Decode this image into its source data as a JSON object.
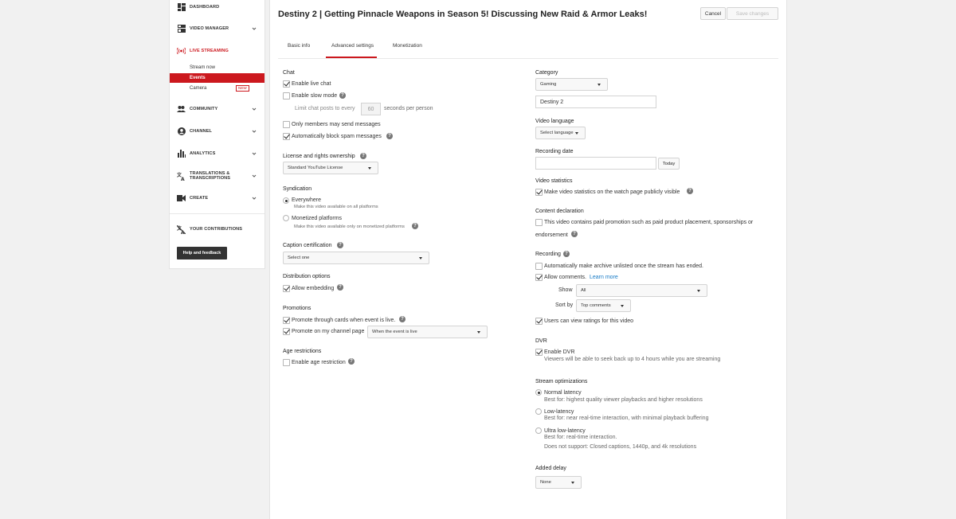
{
  "sidebar": {
    "dashboard": "DASHBOARD",
    "video_manager": "VIDEO MANAGER",
    "live_streaming": "LIVE STREAMING",
    "live_sub": {
      "stream_now": "Stream now",
      "events": "Events",
      "camera": "Camera",
      "new_badge": "NEW"
    },
    "community": "COMMUNITY",
    "channel": "CHANNEL",
    "analytics": "ANALYTICS",
    "translations_line1": "TRANSLATIONS &",
    "translations_line2": "TRANSCRIPTIONS",
    "create": "CREATE",
    "your_contributions": "YOUR CONTRIBUTIONS",
    "help_feedback": "Help and feedback"
  },
  "header": {
    "title": "Destiny 2 | Getting Pinnacle Weapons in Season 5! Discussing New Raid & Armor Leaks!",
    "cancel": "Cancel",
    "save": "Save changes"
  },
  "tabs": [
    "Basic info",
    "Advanced settings",
    "Monetization"
  ],
  "left": {
    "chat": {
      "heading": "Chat",
      "enable_live_chat": "Enable live chat",
      "enable_slow_mode": "Enable slow mode",
      "limit_prefix": "Limit chat posts to every",
      "limit_value": "60",
      "limit_suffix": "seconds per person",
      "members_only": "Only members may send messages",
      "block_spam": "Automatically block spam messages"
    },
    "license": {
      "heading": "License and rights ownership",
      "value": "Standard YouTube License"
    },
    "syndication": {
      "heading": "Syndication",
      "everywhere": "Everywhere",
      "everywhere_desc": "Make this video available on all platforms",
      "monetized": "Monetized platforms",
      "monetized_desc": "Make this video available only on monetized platforms"
    },
    "caption": {
      "heading": "Caption certification",
      "value": "Select one"
    },
    "distribution": {
      "heading": "Distribution options",
      "allow_embedding": "Allow embedding"
    },
    "promotions": {
      "heading": "Promotions",
      "cards": "Promote through cards when event is live.",
      "channel_page": "Promote on my channel page",
      "channel_page_value": "When the event is live"
    },
    "age": {
      "heading": "Age restrictions",
      "enable": "Enable age restriction"
    }
  },
  "right": {
    "category": {
      "heading": "Category",
      "value": "Gaming",
      "game": "Destiny 2"
    },
    "video_language": {
      "heading": "Video language",
      "value": "Select language"
    },
    "recording_date": {
      "heading": "Recording date",
      "value": "",
      "today": "Today"
    },
    "video_statistics": {
      "heading": "Video statistics",
      "label": "Make video statistics on the watch page publicly visible"
    },
    "content_declaration": {
      "heading": "Content declaration",
      "line1": "This video contains paid promotion such as paid product placement, sponsorships or",
      "line2": "endorsement"
    },
    "recording": {
      "heading": "Recording",
      "archive_unlisted": "Automatically make archive unlisted once the stream has ended.",
      "allow_comments": "Allow comments.",
      "learn_more": "Learn more",
      "show_label": "Show",
      "show_value": "All",
      "sort_label": "Sort by",
      "sort_value": "Top comments",
      "ratings": "Users can view ratings for this video"
    },
    "dvr": {
      "heading": "DVR",
      "enable": "Enable DVR",
      "desc": "Viewers will be able to seek back up to 4 hours while you are streaming"
    },
    "stream_opt": {
      "heading": "Stream optimizations",
      "normal": "Normal latency",
      "normal_desc": "Best for: highest quality viewer playbacks and higher resolutions",
      "low": "Low-latency",
      "low_desc": "Best for: near real-time interaction, with minimal playback buffering",
      "ultra": "Ultra low-latency",
      "ultra_desc": "Best for: real-time interaction.",
      "ultra_note": "Does not support: Closed captions, 1440p, and 4k resolutions"
    },
    "added_delay": {
      "heading": "Added delay",
      "value": "None"
    }
  },
  "colors": {
    "accent": "#cc181e",
    "link": "#167ac6"
  }
}
